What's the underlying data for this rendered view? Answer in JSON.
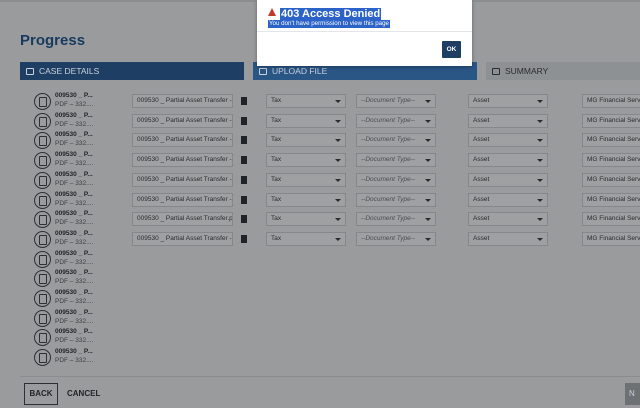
{
  "page": {
    "title": "Progress"
  },
  "steps": [
    {
      "label": "CASE DETAILS",
      "icon": "folder-icon"
    },
    {
      "label": "UPLOAD FILE",
      "icon": "upload-icon"
    },
    {
      "label": "SUMMARY",
      "icon": "summary-icon"
    }
  ],
  "files": [
    {
      "name": "009530 _ P...",
      "meta": "PDF – 332....",
      "title": "009530 _ Partial Asset Transfer -",
      "category": "Tax",
      "doc_type": "--Document Type--",
      "asset": "Asset",
      "provider": "MG Financial Servic"
    },
    {
      "name": "009530 _ P...",
      "meta": "PDF – 332....",
      "title": "009530 _ Partial Asset Transfer -",
      "category": "Tax",
      "doc_type": "--Document Type--",
      "asset": "Asset",
      "provider": "MG Financial Servic"
    },
    {
      "name": "009530 _ P...",
      "meta": "PDF – 332....",
      "title": "009530 _ Partial Asset Transfer -",
      "category": "Tax",
      "doc_type": "--Document Type--",
      "asset": "Asset",
      "provider": "MG Financial Servic"
    },
    {
      "name": "009530 _ P...",
      "meta": "PDF – 332....",
      "title": "009530 _ Partial Asset Transfer -",
      "category": "Tax",
      "doc_type": "--Document Type--",
      "asset": "Asset",
      "provider": "MG Financial Servic"
    },
    {
      "name": "009530 _ P...",
      "meta": "PDF – 332....",
      "title": "009530 _ Partial Asset Transfer -",
      "category": "Tax",
      "doc_type": "--Document Type--",
      "asset": "Asset",
      "provider": "MG Financial Servic"
    },
    {
      "name": "009530 _ P...",
      "meta": "PDF – 332....",
      "title": "009530 _ Partial Asset Transfer -",
      "category": "Tax",
      "doc_type": "--Document Type--",
      "asset": "Asset",
      "provider": "MG Financial Servic"
    },
    {
      "name": "009530 _ P...",
      "meta": "PDF – 332....",
      "title": "009530 _ Partial Asset Transfer.p",
      "category": "Tax",
      "doc_type": "--Document Type--",
      "asset": "Asset",
      "provider": "MG Financial Servic"
    },
    {
      "name": "009530 _ P...",
      "meta": "PDF – 332....",
      "title": "009530 _ Partial Asset Transfer -",
      "category": "Tax",
      "doc_type": "--Document Type--",
      "asset": "Asset",
      "provider": "MG Financial Servic"
    },
    {
      "name": "009530 _ P...",
      "meta": "PDF – 332...."
    },
    {
      "name": "009530 _ P...",
      "meta": "PDF – 332...."
    },
    {
      "name": "009530 _ P...",
      "meta": "PDF – 332...."
    },
    {
      "name": "009530 _ P...",
      "meta": "PDF – 332...."
    },
    {
      "name": "009530 _ P...",
      "meta": "PDF – 332...."
    },
    {
      "name": "009530 _ P...",
      "meta": "PDF – 332...."
    }
  ],
  "footer": {
    "back": "BACK",
    "cancel": "CANCEL",
    "next": "N"
  },
  "modal": {
    "title": "403 Access Denied",
    "message": "You don't have permission to view this page",
    "ok": "OK"
  }
}
